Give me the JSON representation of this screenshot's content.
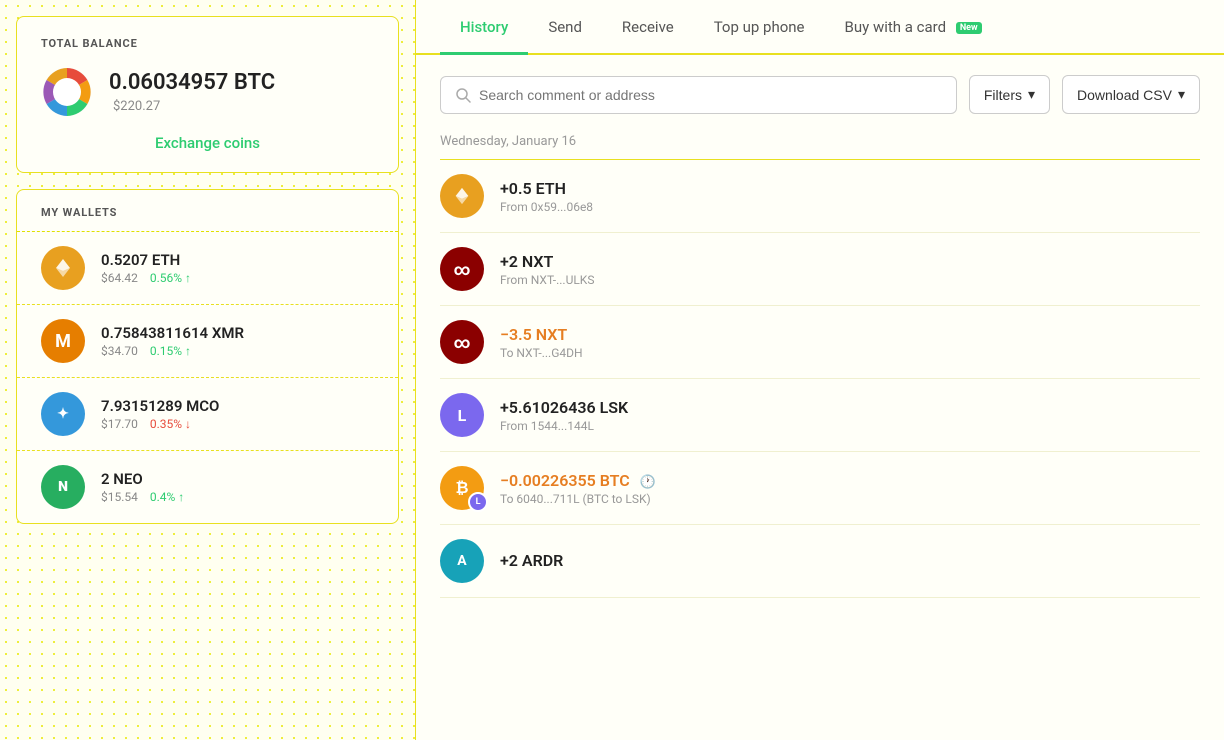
{
  "left": {
    "total_balance_label": "TOTAL BALANCE",
    "btc_amount": "0.06034957 BTC",
    "btc_usd": "$220.27",
    "exchange_coins": "Exchange coins",
    "my_wallets_label": "MY WALLETS",
    "wallets": [
      {
        "id": "eth",
        "amount": "0.5207 ETH",
        "usd": "$64.42",
        "change": "0.56% ↑",
        "change_dir": "up",
        "bg": "#e8a020",
        "symbol": "◆"
      },
      {
        "id": "xmr",
        "amount": "0.75843811614 XMR",
        "usd": "$34.70",
        "change": "0.15% ↑",
        "change_dir": "up",
        "bg": "#e67e00",
        "symbol": "M"
      },
      {
        "id": "mco",
        "amount": "7.93151289 MCO",
        "usd": "$17.70",
        "change": "0.35% ↓",
        "change_dir": "down",
        "bg": "#3498db",
        "symbol": "✦"
      },
      {
        "id": "neo",
        "amount": "2 NEO",
        "usd": "$15.54",
        "change": "0.4% ↑",
        "change_dir": "up",
        "bg": "#27ae60",
        "symbol": "N"
      }
    ]
  },
  "right": {
    "tabs": [
      {
        "id": "history",
        "label": "History",
        "active": true,
        "badge": null
      },
      {
        "id": "send",
        "label": "Send",
        "active": false,
        "badge": null
      },
      {
        "id": "receive",
        "label": "Receive",
        "active": false,
        "badge": null
      },
      {
        "id": "topup",
        "label": "Top up phone",
        "active": false,
        "badge": null
      },
      {
        "id": "buy",
        "label": "Buy with a card",
        "active": false,
        "badge": "New"
      }
    ],
    "search_placeholder": "Search comment or address",
    "filters_label": "Filters",
    "csv_label": "Download CSV",
    "date_group": "Wednesday, January 16",
    "transactions": [
      {
        "id": "eth-tx",
        "amount": "+0.5 ETH",
        "sub": "From 0x59...06e8",
        "type": "positive",
        "icon_bg": "#e8a020",
        "icon_symbol": "◆",
        "icon_color": "white"
      },
      {
        "id": "nxt-in",
        "amount": "+2 NXT",
        "sub": "From NXT-...ULKS",
        "type": "positive",
        "icon_bg": "#8b0000",
        "icon_symbol": "∞",
        "icon_color": "white"
      },
      {
        "id": "nxt-out",
        "amount": "−3.5 NXT",
        "sub": "To NXT-...G4DH",
        "type": "negative",
        "icon_bg": "#8b0000",
        "icon_symbol": "∞",
        "icon_color": "white"
      },
      {
        "id": "lsk-tx",
        "amount": "+5.61026436 LSK",
        "sub": "From 1544...144L",
        "type": "positive",
        "icon_bg": "#7b68ee",
        "icon_symbol": "L",
        "icon_color": "white"
      },
      {
        "id": "btc-lsk",
        "amount": "−0.00226355 BTC",
        "sub": "To 6040...711L (BTC to LSK)",
        "type": "pending",
        "icon_bg": "#f39c12",
        "icon_symbol": "₿",
        "icon_color": "white",
        "overlay": "L",
        "overlay_bg": "#7b68ee",
        "has_clock": true
      },
      {
        "id": "ardr-tx",
        "amount": "+2 ARDR",
        "sub": "",
        "type": "positive",
        "icon_bg": "#17a2b8",
        "icon_symbol": "A",
        "icon_color": "white"
      }
    ]
  }
}
